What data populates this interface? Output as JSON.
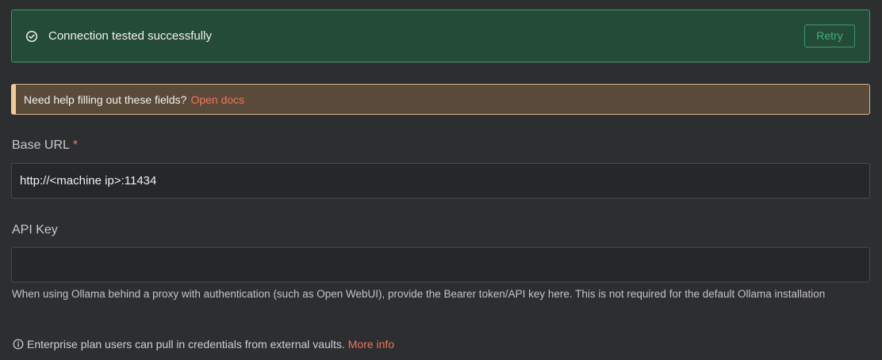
{
  "success_banner": {
    "message": "Connection tested successfully",
    "retry_label": "Retry",
    "icon": "check-circle-icon"
  },
  "docs_callout": {
    "text": "Need help filling out these fields?",
    "link_label": "Open docs"
  },
  "base_url": {
    "label": "Base URL",
    "required_mark": "*",
    "value": "http://<machine ip>:11434"
  },
  "api_key": {
    "label": "API Key",
    "value": "",
    "help_text": "When using Ollama behind a proxy with authentication (such as Open WebUI), provide the Bearer token/API key here. This is not required for the default Ollama installation"
  },
  "enterprise_note": {
    "icon": "info-icon",
    "text": "Enterprise plan users can pull in credentials from external vaults.",
    "link_label": "More info"
  },
  "colors": {
    "background": "#2d2e30",
    "success_bg": "#244a38",
    "success_border": "#3e9a69",
    "warning_bg": "#5a4a3a",
    "warning_accent": "#f0cb96",
    "link": "#f0755e"
  }
}
